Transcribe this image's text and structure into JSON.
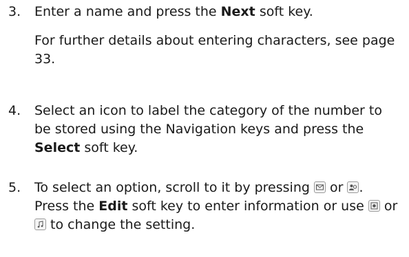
{
  "steps": [
    {
      "number": "3.",
      "text_a": "Enter a name and press the ",
      "bold_a": "Next",
      "text_b": " soft key.",
      "note": "For further details about entering characters, see page 33."
    },
    {
      "number": "4.",
      "text_a": "Select an icon to label the category of the number to be stored using the Navigation keys and press the ",
      "bold_a": "Select",
      "text_b": " soft key."
    },
    {
      "number": "5.",
      "text_a": "To select an option, scroll to it by pressing ",
      "icon_1": "envelope-key-icon",
      "text_or_1": " or ",
      "icon_2": "contacts-key-icon",
      "text_b": ". Press the ",
      "bold_a": "Edit",
      "text_c": " soft key to enter information or use ",
      "icon_3": "camera-key-icon",
      "text_or_2": " or ",
      "icon_4": "music-key-icon",
      "text_d": " to change the setting."
    }
  ]
}
